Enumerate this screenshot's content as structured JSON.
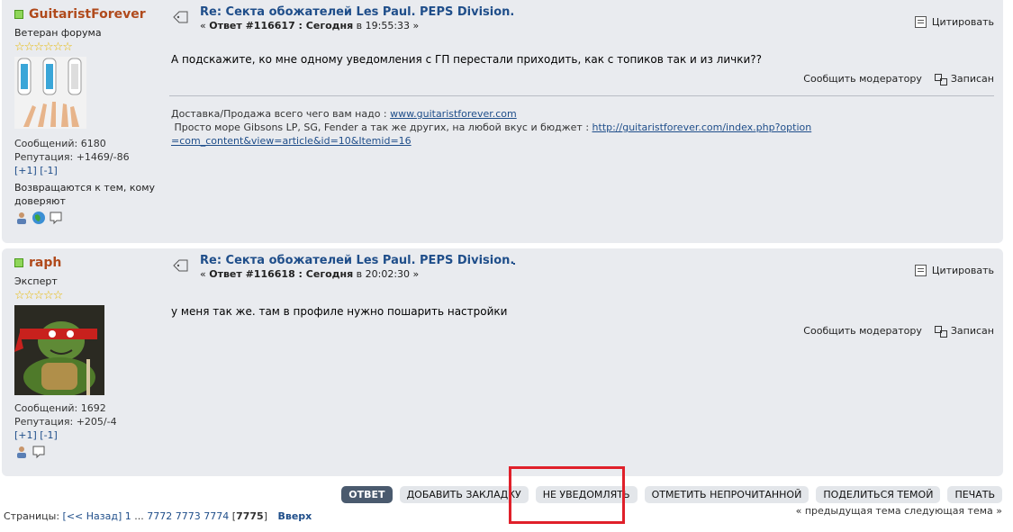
{
  "posts": [
    {
      "poster": {
        "name": "GuitaristForever",
        "group": "Ветеран форума",
        "stars": "☆☆☆☆☆☆",
        "posts": "Сообщений: 6180",
        "reputation": "Репутация: +1469/-86",
        "vote": "[+1] [-1]",
        "custom_title": "Возвращаются к тем, кому доверяют"
      },
      "subject": "Re: Секта обожателей Les Paul. PEPS Division.",
      "meta_prefix": "« ",
      "meta_reply": "Ответ #116617 : Сегодня",
      "meta_time": " в 19:55:33 »",
      "quote_label": "Цитировать",
      "message": "А подскажите, ко мне одному уведомления с ГП перестали приходить, как с топиков так и из лички??",
      "report_label": "Сообщить модератору",
      "logged_label": "Записан",
      "signature": {
        "line1_text": "Доставка/Продажа всего чего вам надо :",
        "line1_link": "www.guitaristforever.com",
        "line2_text": "Просто море Gibsons LP, SG, Fender а так же других, на любой вкус и бюджет :",
        "line2_link": "http://guitaristforever.com/index.php?option=com_content&view=article&id=10&Itemid=16"
      }
    },
    {
      "poster": {
        "name": "raph",
        "group": "Эксперт",
        "stars": "☆☆☆☆☆",
        "posts": "Сообщений: 1692",
        "reputation": "Репутация: +205/-4",
        "vote": "[+1] [-1]"
      },
      "subject": "Re: Секта обожателей Les Paul. PEPS Division.",
      "meta_prefix": "« ",
      "meta_reply": "Ответ #116618 : Сегодня",
      "meta_time": " в 20:02:30 »",
      "quote_label": "Цитировать",
      "message": "у меня так же. там в профиле нужно пошарить настройки",
      "report_label": "Сообщить модератору",
      "logged_label": "Записан"
    }
  ],
  "buttons": {
    "reply": "ОТВЕТ",
    "bookmark": "ДОБАВИТЬ ЗАКЛАДКУ",
    "notify": "НЕ УВЕДОМЛЯТЬ",
    "mark_unread": "ОТМЕТИТЬ НЕПРОЧИТАННОЙ",
    "share": "ПОДЕЛИТЬСЯ ТЕМОЙ",
    "print": "ПЕЧАТЬ"
  },
  "pagination": {
    "label": "Страницы:",
    "prev": "[<< Назад]",
    "first": "1",
    "ellipsis": "...",
    "p1": "7772",
    "p2": "7773",
    "p3": "7774",
    "current": "7775",
    "top": "Вверх"
  },
  "topic_nav": "« предыдущая тема следующая тема »",
  "colors": {
    "accent": "#1f4e8a",
    "poster_name": "#b04a1c",
    "highlight": "#e0202a",
    "post_bg": "#e9ebef"
  }
}
